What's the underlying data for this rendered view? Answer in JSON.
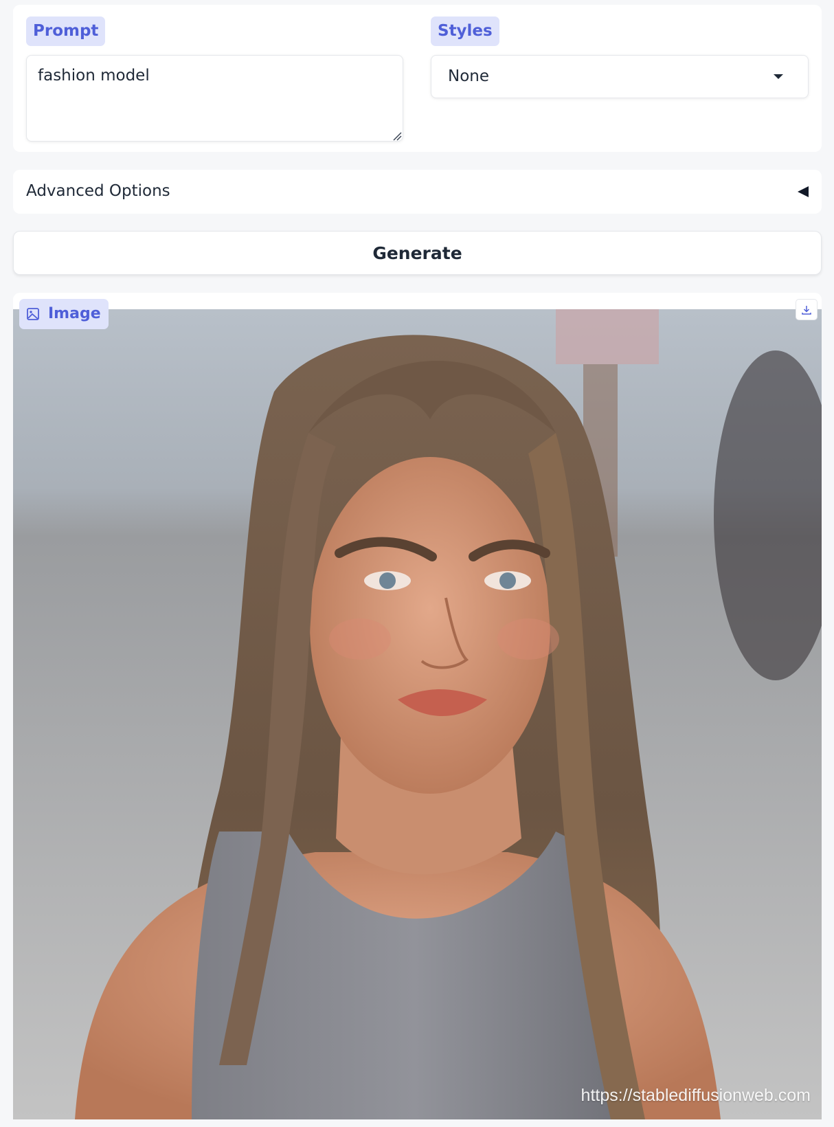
{
  "prompt": {
    "label": "Prompt",
    "value": "fashion model"
  },
  "styles": {
    "label": "Styles",
    "selected": "None"
  },
  "advanced": {
    "label": "Advanced Options"
  },
  "actions": {
    "generate_label": "Generate"
  },
  "output": {
    "label": "Image",
    "watermark": "https://stablediffusionweb.com",
    "icons": [
      "image-icon",
      "download-icon"
    ]
  },
  "colors": {
    "badge_bg": "#dfe3fb",
    "badge_text": "#4f5fd8",
    "page_bg": "#f6f7f9"
  }
}
